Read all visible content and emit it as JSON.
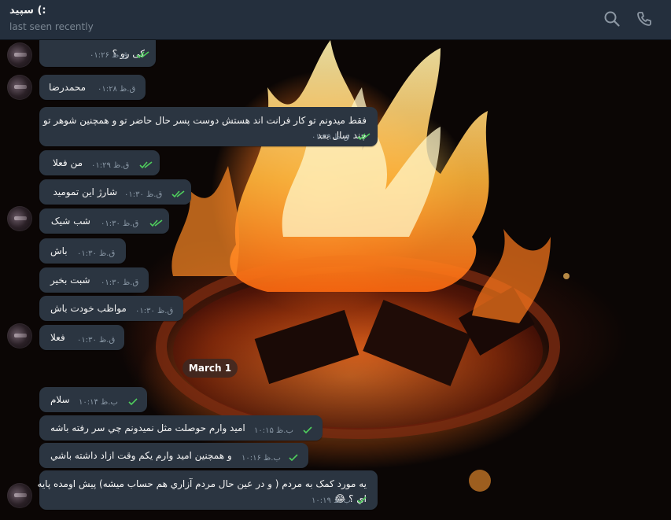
{
  "header": {
    "title": "سپید (:",
    "status": "last seen recently",
    "icons": [
      "search-icon",
      "phone-icon",
      "more-icon"
    ]
  },
  "colors": {
    "header_bg": "#242f3d",
    "bubble_bg": "#2b3541",
    "tick_read": "#4fce5d",
    "time_text": "#8a98a6"
  },
  "messages": [
    {
      "text": "کی رو ؟",
      "time": "ق.ظ ۰۱:۲۶",
      "ticks": "double"
    },
    {
      "text": "محمدرضا",
      "time": "ق.ظ ۰۱:۲۸",
      "ticks": "none"
    },
    {
      "text": "فقط میدونم تو کار فرانت اند هستش دوست پسر حال حاضر تو و همچنین شوهر تو چند سال بعد",
      "time": "ق.ظ ۰۱:۲۹",
      "ticks": "double"
    },
    {
      "text": "من فعلا",
      "time": "ق.ظ ۰۱:۲۹",
      "ticks": "double"
    },
    {
      "text": "شارژ این تمومید",
      "time": "ق.ظ ۰۱:۳۰",
      "ticks": "double"
    },
    {
      "text": "شب شیک",
      "time": "ق.ظ ۰۱:۳۰",
      "ticks": "double"
    },
    {
      "text": "باش",
      "time": "ق.ظ ۰۱:۳۰",
      "ticks": "none"
    },
    {
      "text": "شبت بخیر",
      "time": "ق.ظ ۰۱:۳۰",
      "ticks": "none"
    },
    {
      "text": "مواظب خودت باش",
      "time": "ق.ظ ۰۱:۳۰",
      "ticks": "none"
    },
    {
      "text": "فعلا",
      "time": "ق.ظ ۰۱:۳۰",
      "ticks": "none"
    },
    {
      "text": "سلام",
      "time": "ب.ظ ۱۰:۱۴",
      "ticks": "single"
    },
    {
      "text": "امید وارم حوصلت مثل نمیدونم چي سر رفته باشه",
      "time": "ب.ظ ۱۰:۱۵",
      "ticks": "single"
    },
    {
      "text": "و همچنین امید وارم یکم وقت ازاد داشته باشي",
      "time": "ب.ظ ۱۰:۱۶",
      "ticks": "single"
    },
    {
      "text": "یه مورد کمک به مردم ( و در عین حال مردم آزاري هم حساب میشه) پیش اومده پایه اي ؟ 😂",
      "time": "ب.ظ ۱۰:۱۹",
      "ticks": "single"
    }
  ],
  "date_separator": "March 1"
}
